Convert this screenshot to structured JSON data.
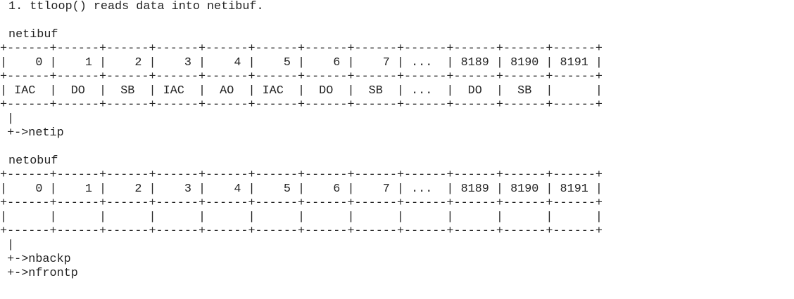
{
  "intro": "1. ttloop() reads data into netibuf.",
  "netibuf": {
    "label": "netibuf",
    "table": "+------+------+------+------+------+------+------+------+------+------+------+------+\n|    0 |    1 |    2 |    3 |    4 |    5 |    6 |    7 | ...  | 8189 | 8190 | 8191 |\n+------+------+------+------+------+------+------+------+------+------+------+------+\n| IAC  |  DO  |  SB  | IAC  |  AO  | IAC  |  DO  |  SB  | ...  |  DO  |  SB  |      |\n+------+------+------+------+------+------+------+------+------+------+------+------+\n |\n +->netip"
  },
  "netobuf": {
    "label": "netobuf",
    "table": "+------+------+------+------+------+------+------+------+------+------+------+------+\n|    0 |    1 |    2 |    3 |    4 |    5 |    6 |    7 | ...  | 8189 | 8190 | 8191 |\n+------+------+------+------+------+------+------+------+------+------+------+------+\n|      |      |      |      |      |      |      |      |      |      |      |      |\n+------+------+------+------+------+------+------+------+------+------+------+------+\n |\n +->nbackp\n +->nfrontp"
  }
}
